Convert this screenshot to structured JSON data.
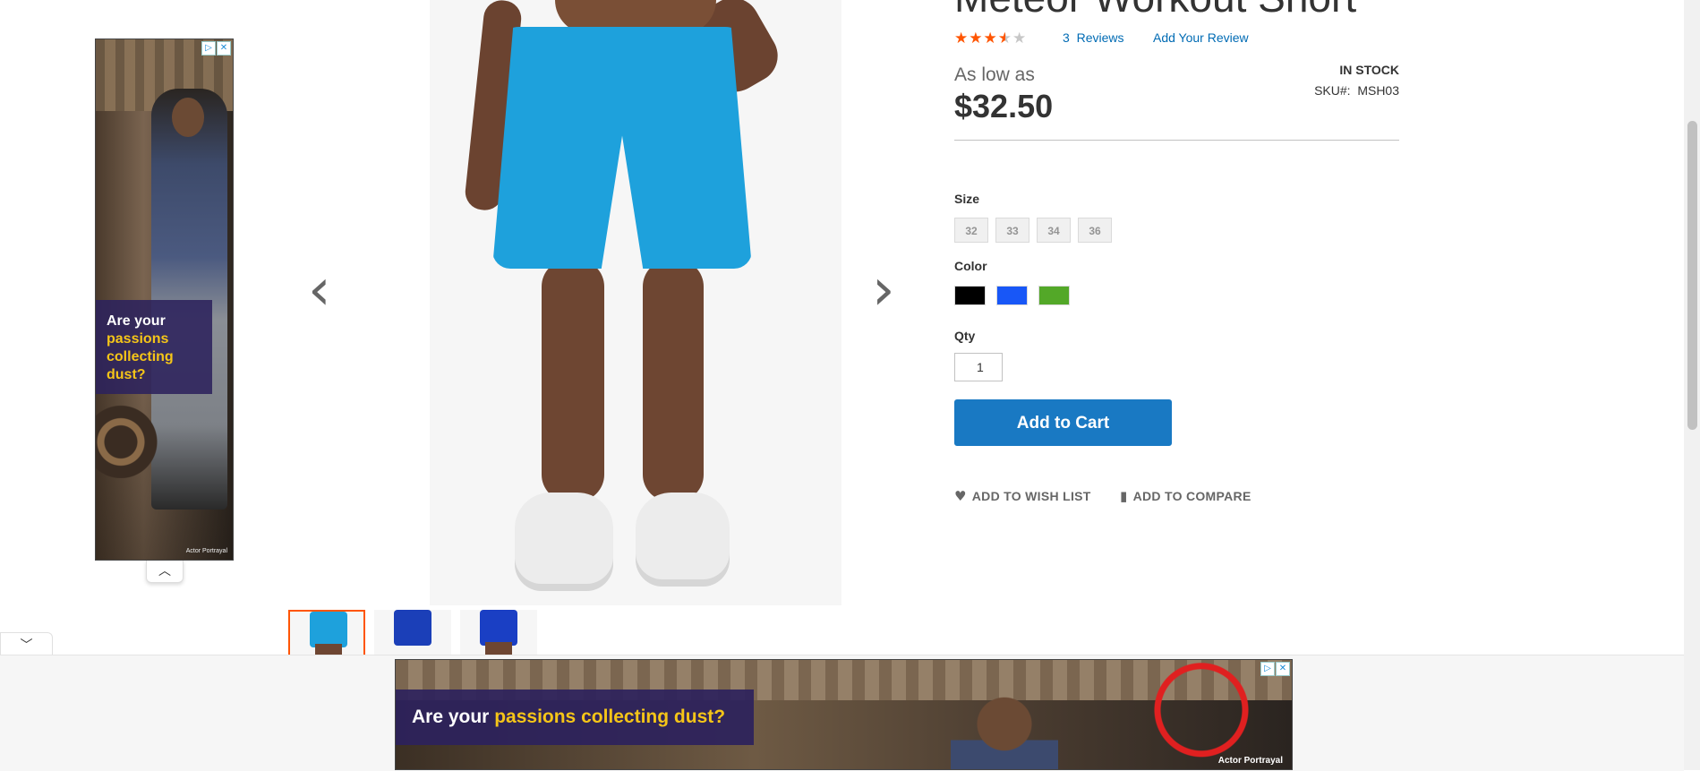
{
  "product": {
    "title": "Meteor Workout Short",
    "rating_percent": 70,
    "reviews_count": "3",
    "reviews_label": "Reviews",
    "add_review_label": "Add Your Review",
    "price_prefix": "As low as",
    "price": "$32.50",
    "stock_status": "In stock",
    "sku_label": "SKU#:",
    "sku": "MSH03"
  },
  "options": {
    "size_label": "Size",
    "sizes": [
      "32",
      "33",
      "34",
      "36"
    ],
    "color_label": "Color",
    "colors": [
      "#000000",
      "#1857f7",
      "#53a828"
    ],
    "qty_label": "Qty",
    "qty_value": "1"
  },
  "actions": {
    "add_to_cart": "Add to Cart",
    "wishlist": "Add to Wish List",
    "compare": "Add to Compare"
  },
  "gallery": {
    "prev_icon": "chevron-left-icon",
    "next_icon": "chevron-right-icon",
    "thumbnails": [
      {
        "color": "#1ea1dc",
        "active": true
      },
      {
        "color": "#1b3fb8",
        "active": false
      },
      {
        "color": "#1a3fc4",
        "active": false
      }
    ]
  },
  "ads": {
    "side_headline_1": "Are your ",
    "side_headline_hl": "passions collecting dust?",
    "side_portrayal": "Actor Portrayal",
    "anchor_headline_1": "Are your ",
    "anchor_headline_hl": "passions collecting dust?",
    "anchor_portrayal": "Actor Portrayal"
  },
  "colors": {
    "accent": "#1979c3",
    "link": "#006bb4",
    "star": "#ff5501"
  }
}
